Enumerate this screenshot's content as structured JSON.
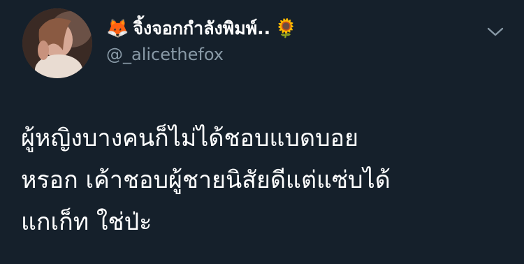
{
  "tweet": {
    "author": {
      "display_name": "จิ้งจอกกำลังพิมพ์..",
      "leading_emoji": "🦊",
      "trailing_emoji": "🌻",
      "handle": "@_alicethefox",
      "avatar": "profile-photo"
    },
    "menu_icon": "chevron-down-icon",
    "text_lines": [
      "ผู้หญิงบางคนก็ไม่ได้ชอบแบดบอย",
      "หรอก เค้าชอบผู้ชายนิสัยดีแต่แซ่บได้",
      "แกเก็ท ใช่ป่ะ"
    ]
  },
  "colors": {
    "background": "#15202b",
    "primary_text": "#ffffff",
    "secondary_text": "#8899a6"
  }
}
